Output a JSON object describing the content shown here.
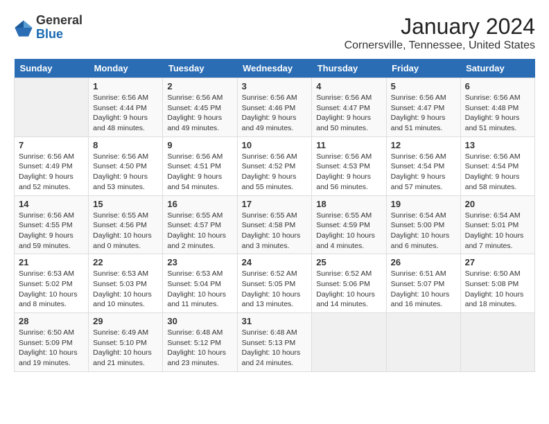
{
  "header": {
    "logo_general": "General",
    "logo_blue": "Blue",
    "month_title": "January 2024",
    "location": "Cornersville, Tennessee, United States"
  },
  "columns": [
    "Sunday",
    "Monday",
    "Tuesday",
    "Wednesday",
    "Thursday",
    "Friday",
    "Saturday"
  ],
  "weeks": [
    [
      {
        "num": "",
        "info": ""
      },
      {
        "num": "1",
        "info": "Sunrise: 6:56 AM\nSunset: 4:44 PM\nDaylight: 9 hours\nand 48 minutes."
      },
      {
        "num": "2",
        "info": "Sunrise: 6:56 AM\nSunset: 4:45 PM\nDaylight: 9 hours\nand 49 minutes."
      },
      {
        "num": "3",
        "info": "Sunrise: 6:56 AM\nSunset: 4:46 PM\nDaylight: 9 hours\nand 49 minutes."
      },
      {
        "num": "4",
        "info": "Sunrise: 6:56 AM\nSunset: 4:47 PM\nDaylight: 9 hours\nand 50 minutes."
      },
      {
        "num": "5",
        "info": "Sunrise: 6:56 AM\nSunset: 4:47 PM\nDaylight: 9 hours\nand 51 minutes."
      },
      {
        "num": "6",
        "info": "Sunrise: 6:56 AM\nSunset: 4:48 PM\nDaylight: 9 hours\nand 51 minutes."
      }
    ],
    [
      {
        "num": "7",
        "info": "Sunrise: 6:56 AM\nSunset: 4:49 PM\nDaylight: 9 hours\nand 52 minutes."
      },
      {
        "num": "8",
        "info": "Sunrise: 6:56 AM\nSunset: 4:50 PM\nDaylight: 9 hours\nand 53 minutes."
      },
      {
        "num": "9",
        "info": "Sunrise: 6:56 AM\nSunset: 4:51 PM\nDaylight: 9 hours\nand 54 minutes."
      },
      {
        "num": "10",
        "info": "Sunrise: 6:56 AM\nSunset: 4:52 PM\nDaylight: 9 hours\nand 55 minutes."
      },
      {
        "num": "11",
        "info": "Sunrise: 6:56 AM\nSunset: 4:53 PM\nDaylight: 9 hours\nand 56 minutes."
      },
      {
        "num": "12",
        "info": "Sunrise: 6:56 AM\nSunset: 4:54 PM\nDaylight: 9 hours\nand 57 minutes."
      },
      {
        "num": "13",
        "info": "Sunrise: 6:56 AM\nSunset: 4:54 PM\nDaylight: 9 hours\nand 58 minutes."
      }
    ],
    [
      {
        "num": "14",
        "info": "Sunrise: 6:56 AM\nSunset: 4:55 PM\nDaylight: 9 hours\nand 59 minutes."
      },
      {
        "num": "15",
        "info": "Sunrise: 6:55 AM\nSunset: 4:56 PM\nDaylight: 10 hours\nand 0 minutes."
      },
      {
        "num": "16",
        "info": "Sunrise: 6:55 AM\nSunset: 4:57 PM\nDaylight: 10 hours\nand 2 minutes."
      },
      {
        "num": "17",
        "info": "Sunrise: 6:55 AM\nSunset: 4:58 PM\nDaylight: 10 hours\nand 3 minutes."
      },
      {
        "num": "18",
        "info": "Sunrise: 6:55 AM\nSunset: 4:59 PM\nDaylight: 10 hours\nand 4 minutes."
      },
      {
        "num": "19",
        "info": "Sunrise: 6:54 AM\nSunset: 5:00 PM\nDaylight: 10 hours\nand 6 minutes."
      },
      {
        "num": "20",
        "info": "Sunrise: 6:54 AM\nSunset: 5:01 PM\nDaylight: 10 hours\nand 7 minutes."
      }
    ],
    [
      {
        "num": "21",
        "info": "Sunrise: 6:53 AM\nSunset: 5:02 PM\nDaylight: 10 hours\nand 8 minutes."
      },
      {
        "num": "22",
        "info": "Sunrise: 6:53 AM\nSunset: 5:03 PM\nDaylight: 10 hours\nand 10 minutes."
      },
      {
        "num": "23",
        "info": "Sunrise: 6:53 AM\nSunset: 5:04 PM\nDaylight: 10 hours\nand 11 minutes."
      },
      {
        "num": "24",
        "info": "Sunrise: 6:52 AM\nSunset: 5:05 PM\nDaylight: 10 hours\nand 13 minutes."
      },
      {
        "num": "25",
        "info": "Sunrise: 6:52 AM\nSunset: 5:06 PM\nDaylight: 10 hours\nand 14 minutes."
      },
      {
        "num": "26",
        "info": "Sunrise: 6:51 AM\nSunset: 5:07 PM\nDaylight: 10 hours\nand 16 minutes."
      },
      {
        "num": "27",
        "info": "Sunrise: 6:50 AM\nSunset: 5:08 PM\nDaylight: 10 hours\nand 18 minutes."
      }
    ],
    [
      {
        "num": "28",
        "info": "Sunrise: 6:50 AM\nSunset: 5:09 PM\nDaylight: 10 hours\nand 19 minutes."
      },
      {
        "num": "29",
        "info": "Sunrise: 6:49 AM\nSunset: 5:10 PM\nDaylight: 10 hours\nand 21 minutes."
      },
      {
        "num": "30",
        "info": "Sunrise: 6:48 AM\nSunset: 5:12 PM\nDaylight: 10 hours\nand 23 minutes."
      },
      {
        "num": "31",
        "info": "Sunrise: 6:48 AM\nSunset: 5:13 PM\nDaylight: 10 hours\nand 24 minutes."
      },
      {
        "num": "",
        "info": ""
      },
      {
        "num": "",
        "info": ""
      },
      {
        "num": "",
        "info": ""
      }
    ]
  ]
}
